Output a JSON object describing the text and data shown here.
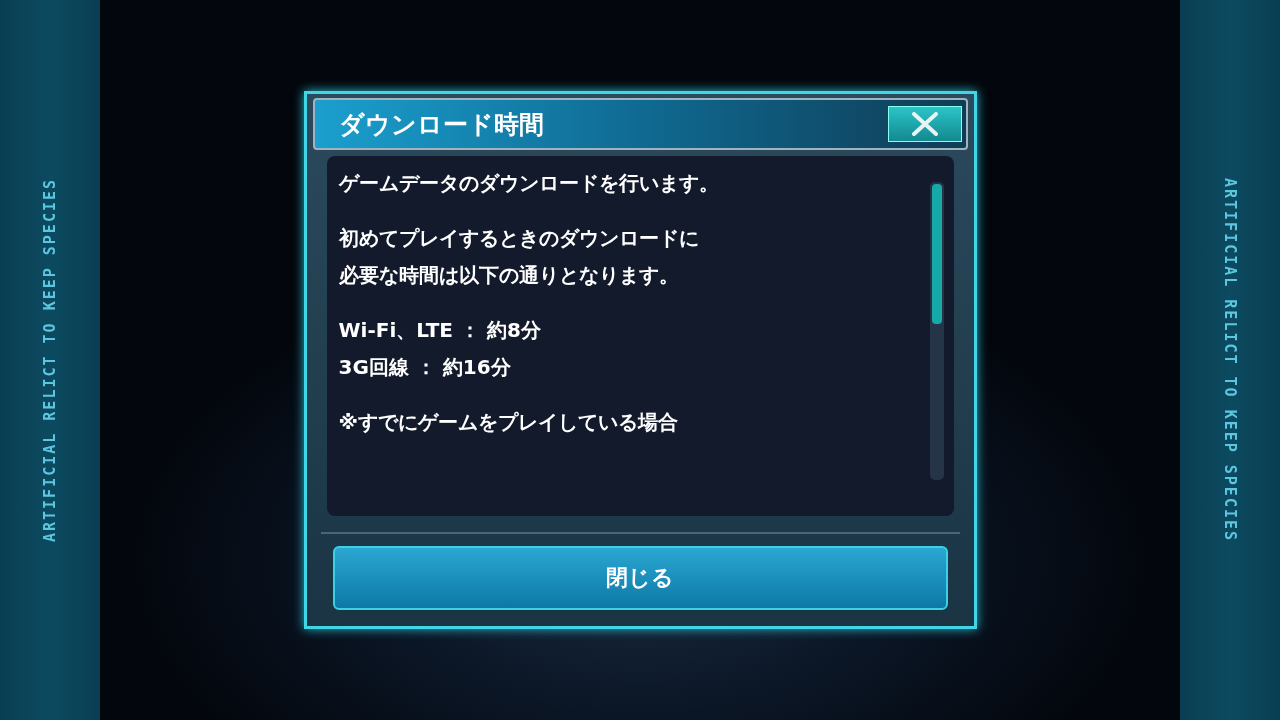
{
  "side_text_left": "ARTIFICIAL RELICT TO KEEP SPECIES",
  "side_text_right": "ARTIFICIAL RELICT TO KEEP SPECIES",
  "dialog": {
    "title": "ダウンロード時間",
    "paragraphs": [
      [
        "ゲームデータのダウンロードを行います。"
      ],
      [
        "初めてプレイするときのダウンロードに",
        "必要な時間は以下の通りとなります。"
      ],
      [
        "Wi-Fi、LTE ： 約8分",
        "3G回線 ： 約16分"
      ],
      [
        "※すでにゲームをプレイしている場合"
      ]
    ],
    "button": "閉じる"
  }
}
